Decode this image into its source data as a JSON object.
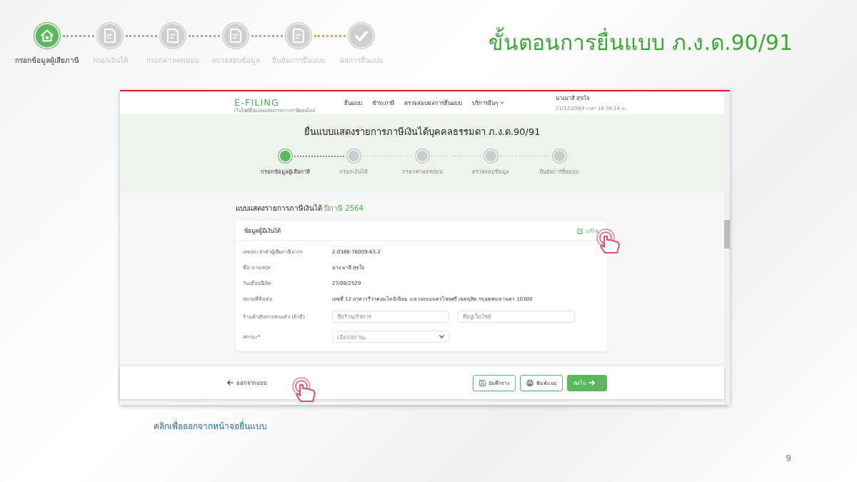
{
  "slide": {
    "title": "ขั้นตอนการยื่นแบบ ภ.ง.ด.90/91",
    "page_number": "9",
    "caption": "คลิกเพื่อออกจากหน้าจอยื่นแบบ",
    "steps": [
      {
        "label": "กรอกข้อมูลผู้เสียภาษี",
        "selected": true,
        "kind": "house"
      },
      {
        "label": "กรอกเงินได้",
        "selected": false,
        "kind": "doc"
      },
      {
        "label": "กรอกค่าลดหย่อน",
        "selected": false,
        "kind": "doc"
      },
      {
        "label": "ตรวจสอบข้อมูล",
        "selected": false,
        "kind": "doc"
      },
      {
        "label": "ยืนยันการยื่นแบบ",
        "selected": false,
        "kind": "doc"
      },
      {
        "label": "ผลการยื่นแบบ",
        "selected": false,
        "kind": "check"
      }
    ]
  },
  "screenshot": {
    "logo": "E-FILING",
    "logo_subtitle": "เว็บไซต์ยื่นแบบแสดงรายการภาษีออนไลน์",
    "nav": [
      "ยื่นแบบ",
      "ชำระภาษี",
      "ตรวจสอบผลการยื่นแบบ",
      "บริการอื่นๆ"
    ],
    "user": {
      "name": "นางมาลี สุขใจ",
      "login_time": "21/12/2564 เวลา 16:34:14 น."
    },
    "title": "ยื่นแบบแสดงรายการภาษีเงินได้บุคคลธรรมดา ภ.ง.ด.90/91",
    "steps": [
      {
        "label": "กรอกข้อมูลผู้เสียภาษี",
        "selected": true
      },
      {
        "label": "กรอกเงินได้",
        "selected": false
      },
      {
        "label": "กรอกค่าลดหย่อน",
        "selected": false
      },
      {
        "label": "ตรวจสอบข้อมูล",
        "selected": false
      },
      {
        "label": "ยืนยันการยื่นแบบ",
        "selected": false
      }
    ],
    "section_title": "แบบแสดงรายการภาษีเงินได้",
    "tax_year": "ปีภาษี 2564",
    "card": {
      "title": "ข้อมูลผู้มีเงินได้",
      "edit": "แก้ไข",
      "rows": [
        {
          "label": "เลขประจำตัวผู้เสียภาษีอากร",
          "value": "2-0388-78009-63-2"
        },
        {
          "label": "ชื่อ-นามสกุล",
          "value": "นาง มาลี สุขใจ"
        },
        {
          "label": "วันเดือนปีเกิด",
          "value": "27/08/2529"
        },
        {
          "label": "สถานที่ติดต่อ",
          "value": "เลขที่ 12 อาคารรีว่าคอนโดมิเนียม แขวงถนนนครไชยศรี เขตดุสิต กรุงเทพมหานคร 10300"
        }
      ],
      "shop": {
        "label": "ร้านค้า/กิจการส่วนตัว (ถ้ามี)",
        "name_placeholder": "ชื่อร้าน/กิจการ",
        "website_placeholder": "ที่อยู่เว็บไซต์"
      },
      "status": {
        "label": "สถานะ*",
        "placeholder": "เลือกสถานะ"
      }
    },
    "footer": {
      "exit": "ออกจากแบบ",
      "save": "บันทึกร่าง",
      "print": "พิมพ์แบบ",
      "next": "ถัดไป"
    }
  }
}
